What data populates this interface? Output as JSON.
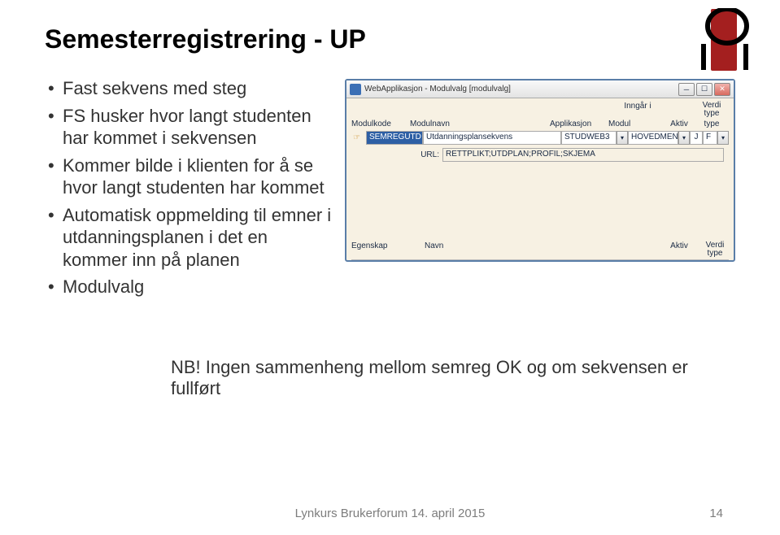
{
  "title": "Semesterregistrering - UP",
  "bullets": [
    "Fast sekvens med steg",
    "FS husker hvor langt studenten har kommet i sekvensen",
    "Kommer bilde i klienten for å se hvor langt studenten har kommet",
    "Automatisk oppmelding til emner i utdanningsplanen i det en kommer inn på planen",
    "Modulvalg"
  ],
  "note": "NB! Ingen sammenheng mellom semreg OK og om sekvensen er fullført",
  "footer": "Lynkurs Brukerforum 14. april 2015",
  "page_number": "14",
  "window": {
    "title": "WebApplikasjon - Modulvalg [modulvalg]",
    "group_label_top": "Inngår i",
    "headers": {
      "modulkode": "Modulkode",
      "modulnavn": "Modulnavn",
      "applikasjon": "Applikasjon",
      "modul": "Modul",
      "aktiv": "Aktiv",
      "verdi_type": "Verdi\ntype"
    },
    "row": {
      "modulkode": "SEMREGUTD",
      "modulnavn": "Utdanningsplansekvens",
      "applikasjon": "STUDWEB3",
      "modul": "HOVEDMENY",
      "aktiv": "J",
      "verdi_type": "F"
    },
    "url_label": "URL:",
    "url_value": "RETTPLIKT;UTDPLAN;PROFIL;SKJEMA",
    "lower_headers": {
      "egenskap": "Egenskap",
      "navn": "Navn",
      "aktiv": "Aktiv",
      "verdi_type": "Verdi\ntype"
    }
  }
}
